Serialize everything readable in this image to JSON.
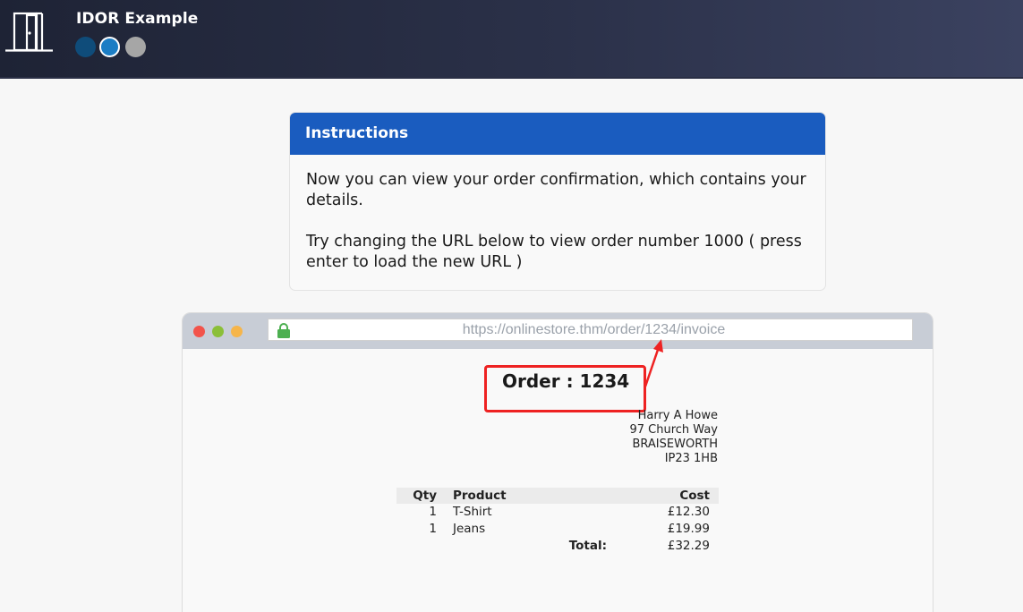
{
  "app": {
    "title": "IDOR Example",
    "steps": [
      {
        "state": "completed",
        "color": "#0f4c7a"
      },
      {
        "state": "current",
        "color": "#1b7dc4"
      },
      {
        "state": "pending",
        "color": "#a6a6a6"
      }
    ]
  },
  "instructions": {
    "header": "Instructions",
    "paragraph_1": "Now you can view your order confirmation, which contains your details.",
    "paragraph_2": "Try changing the URL below to view order number 1000 ( press enter to load the new URL )"
  },
  "browser": {
    "url": "https://onlinestore.thm/order/1234/invoice",
    "lock_color": "#4caf50"
  },
  "invoice": {
    "order_label": "Order : 1234",
    "address": [
      "Harry A Howe",
      "97 Church Way",
      "BRAISEWORTH",
      "IP23 1HB"
    ],
    "columns": {
      "qty": "Qty",
      "product": "Product",
      "cost": "Cost"
    },
    "rows": [
      {
        "qty": "1",
        "product": "T-Shirt",
        "cost": "£12.30"
      },
      {
        "qty": "1",
        "product": "Jeans",
        "cost": "£19.99"
      }
    ],
    "total_label": "Total:",
    "total_value": "£32.29"
  },
  "colors": {
    "header_bar": "#1a5cbf",
    "highlight": "#ee2222"
  }
}
